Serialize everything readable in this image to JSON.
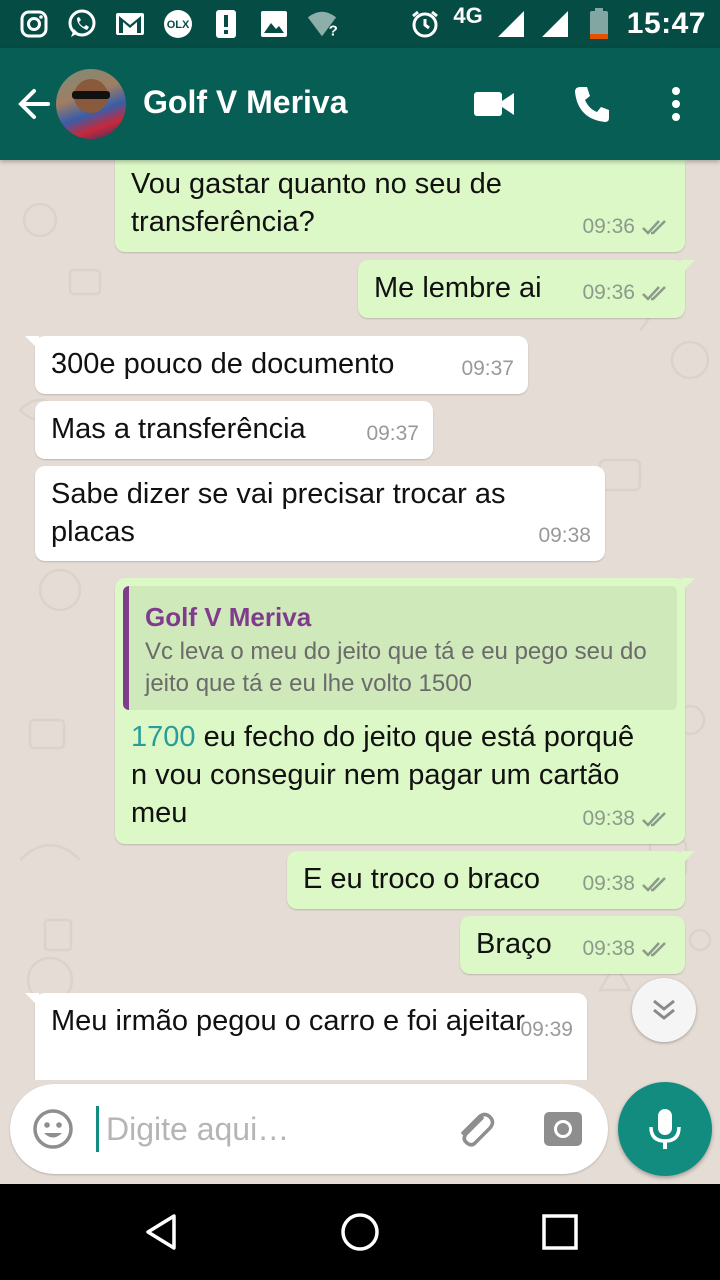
{
  "status_bar": {
    "time": "15:47",
    "network": "4G",
    "icons": [
      "instagram-icon",
      "whatsapp-icon",
      "gmail-icon",
      "olx-icon",
      "alert-icon",
      "image-icon",
      "wifi-unknown-icon",
      "alarm-icon",
      "signal-icon",
      "signal-icon",
      "battery-low-icon"
    ],
    "olx_label": "OLX"
  },
  "header": {
    "contact_name": "Golf V Meriva",
    "icons": [
      "back-arrow-icon",
      "video-call-icon",
      "phone-icon",
      "more-vert-icon"
    ]
  },
  "messages": [
    {
      "id": "m1",
      "direction": "out",
      "text": "Vou gastar quanto no seu de transferência?",
      "time": "09:36",
      "status": "read"
    },
    {
      "id": "m2",
      "direction": "out",
      "text": "Me lembre ai",
      "time": "09:36",
      "status": "read"
    },
    {
      "id": "m3",
      "direction": "in",
      "text": "300e pouco de documento",
      "time": "09:37"
    },
    {
      "id": "m4",
      "direction": "in",
      "text": "Mas a transferência",
      "time": "09:37"
    },
    {
      "id": "m5",
      "direction": "in",
      "text": "Sabe dizer se vai precisar trocar as placas",
      "time": "09:38"
    },
    {
      "id": "m6",
      "direction": "out",
      "quote_author": "Golf V Meriva",
      "quote_text": "Vc leva o meu do jeito que tá e eu pego seu do jeito que tá  e eu lhe volto 1500",
      "text_number": "1700",
      "text_rest": " eu fecho do jeito que está porquê n vou conseguir nem pagar um cartão meu",
      "time": "09:38",
      "status": "read"
    },
    {
      "id": "m7",
      "direction": "out",
      "text": "E eu troco o braco",
      "time": "09:38",
      "status": "read"
    },
    {
      "id": "m8",
      "direction": "out",
      "text": "Braço",
      "time": "09:38",
      "status": "read"
    },
    {
      "id": "m9",
      "direction": "in",
      "text": "Meu irmão pegou o carro e foi ajeitar",
      "time": "09:39"
    }
  ],
  "composer": {
    "placeholder": "Digite aqui…",
    "value": ""
  },
  "colors": {
    "header": "#075e54",
    "status_bar": "#054d44",
    "outgoing_bubble": "#dcf8c6",
    "incoming_bubble": "#ffffff",
    "accent": "#128c7e",
    "quote_author": "#7f3c8d",
    "read_tick": "#8c9a8a"
  }
}
